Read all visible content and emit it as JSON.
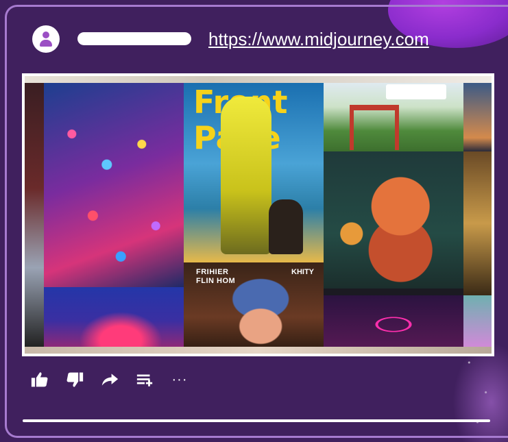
{
  "post": {
    "url": "https://www.midjourney.com",
    "url_href": "https://www.midjourney.com"
  },
  "thumbnail": {
    "poster_title": "Front\nPage",
    "caption_left": "FRIHIER\nFLIN HOM",
    "caption_right": "KHITY"
  },
  "actions": [
    {
      "icon": "thumbs-up-icon"
    },
    {
      "icon": "thumbs-down-icon"
    },
    {
      "icon": "share-arrow-icon"
    },
    {
      "icon": "add-to-playlist-icon"
    },
    {
      "icon": "more-icon",
      "label": "···"
    }
  ],
  "colors": {
    "background": "#40205e",
    "card_border": "#a77bd0",
    "avatar_fill": "#9b4fc4",
    "text": "#ffffff"
  }
}
